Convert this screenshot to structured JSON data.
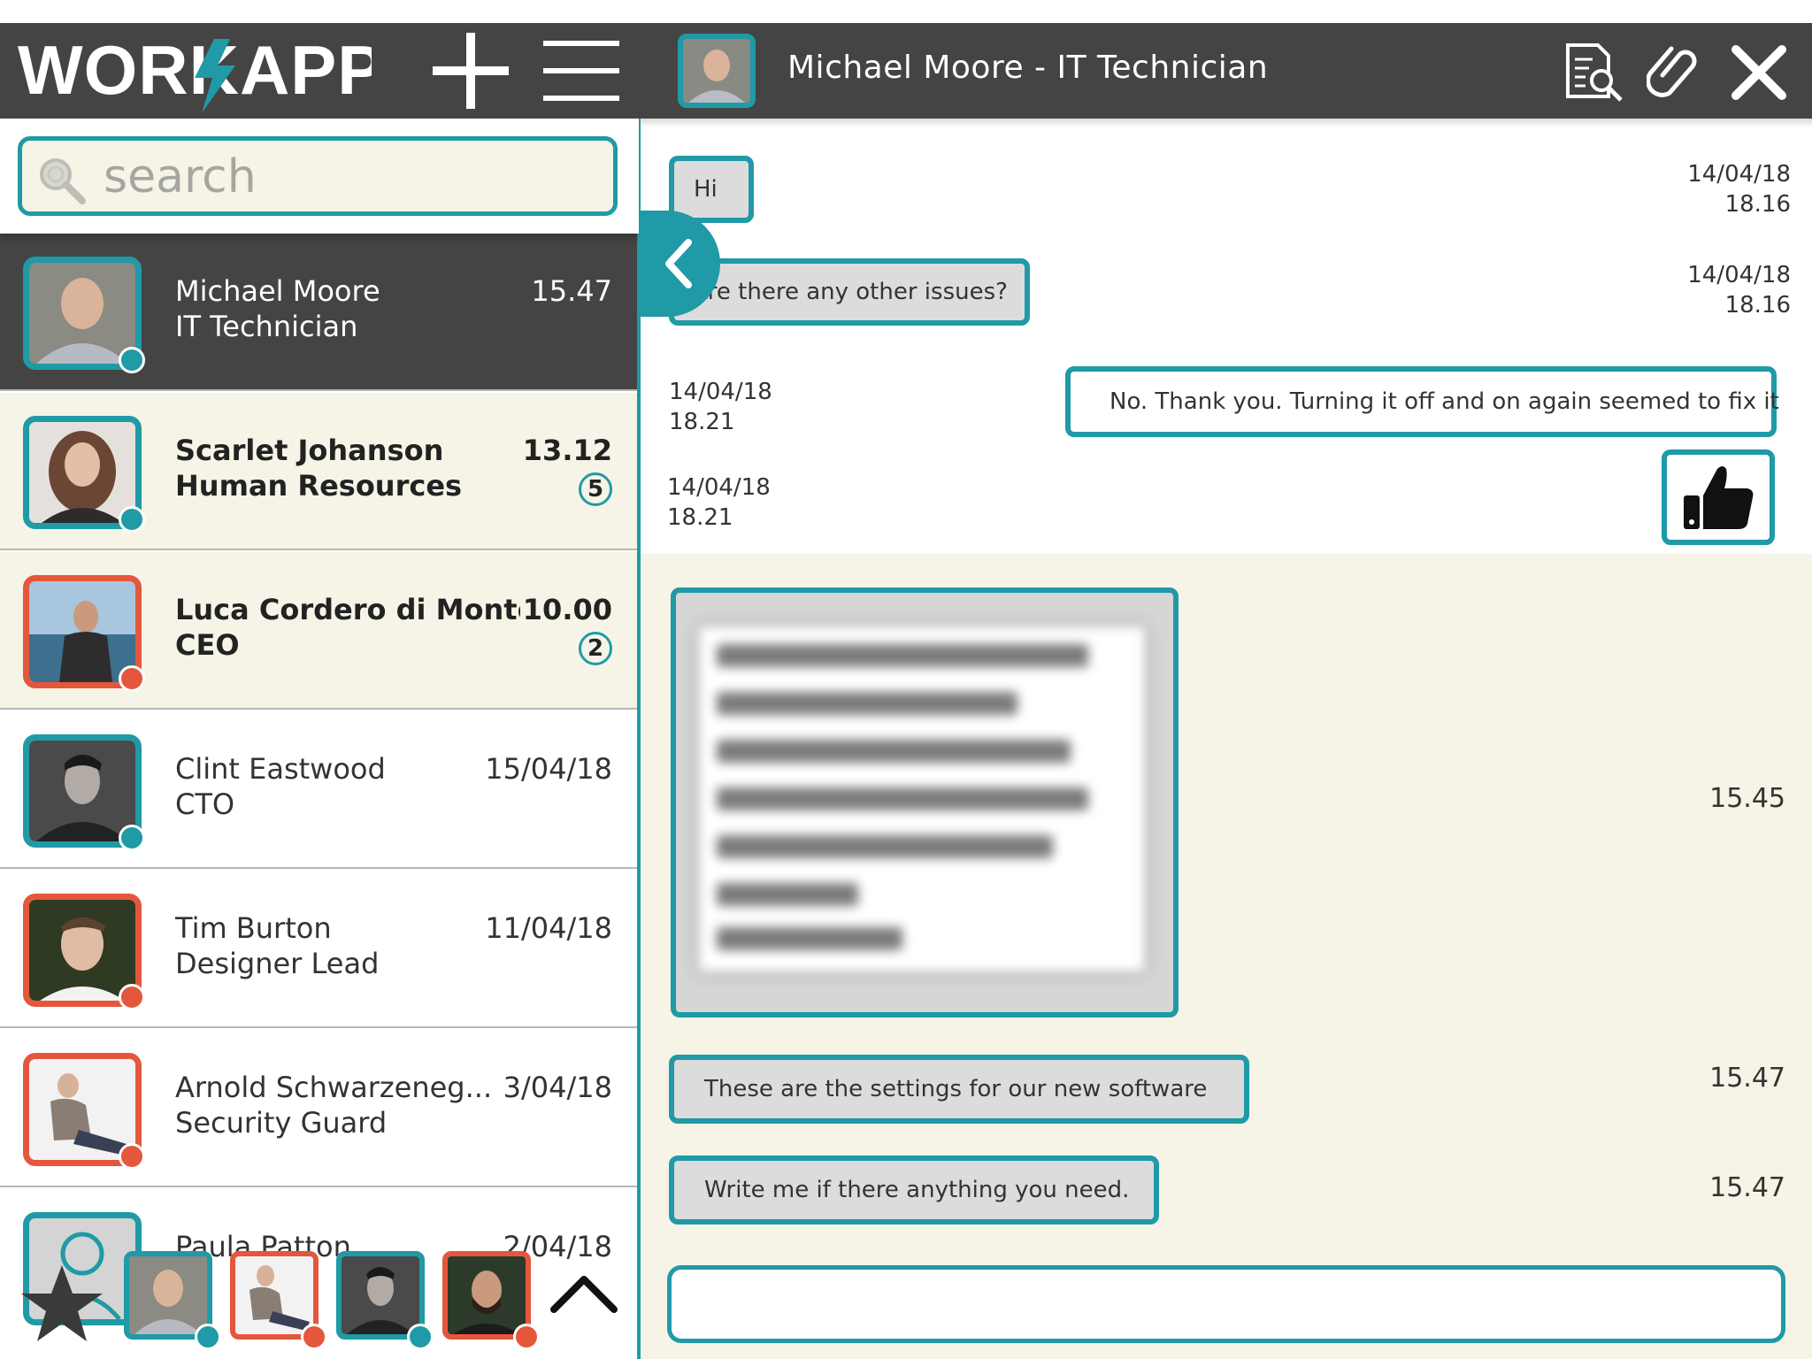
{
  "app": {
    "logo_text": "WORKAPP"
  },
  "header": {
    "title": "Michael Moore - IT Technician"
  },
  "search": {
    "placeholder": "search"
  },
  "contacts": [
    {
      "name": "Michael Moore",
      "role": "IT Technician",
      "time": "15.47",
      "badge": ""
    },
    {
      "name": "Scarlet Johanson",
      "role": "Human Resources",
      "time": "13.12",
      "badge": "5"
    },
    {
      "name": "Luca Cordero di Monte...",
      "role": "CEO",
      "time": "10.00",
      "badge": "2"
    },
    {
      "name": "Clint Eastwood",
      "role": "CTO",
      "time": "15/04/18",
      "badge": ""
    },
    {
      "name": "Tim Burton",
      "role": "Designer Lead",
      "time": "11/04/18",
      "badge": ""
    },
    {
      "name": "Arnold Schwarzeneg...",
      "role": "Security Guard",
      "time": "3/04/18",
      "badge": ""
    },
    {
      "name": "Paula Patton",
      "role": "",
      "time": "2/04/18",
      "badge": ""
    }
  ],
  "messages": [
    {
      "text": "Hi",
      "date": "14/04/18",
      "time": "18.16"
    },
    {
      "text": "Are there any other issues?",
      "date": "14/04/18",
      "time": "18.16"
    },
    {
      "text": "No. Thank you. Turning it off and on again seemed to fix it",
      "date": "14/04/18",
      "time": "18.21"
    },
    {
      "text": "",
      "date": "14/04/18",
      "time": "18.21"
    },
    {
      "text": "",
      "date": "",
      "time": "15.45"
    },
    {
      "text": "These are the settings for our new software",
      "date": "",
      "time": "15.47"
    },
    {
      "text": "Write me if there anything you need.",
      "date": "",
      "time": "15.47"
    }
  ],
  "colors": {
    "accent": "#1f9aa6",
    "alert": "#e4573d",
    "dark": "#444444",
    "cream": "#f5f4e6"
  },
  "icons": [
    "plus-icon",
    "hamburger-menu-icon",
    "search-document-icon",
    "paperclip-icon",
    "close-icon",
    "magnifier-icon",
    "chevron-left-icon",
    "thumbs-up-icon",
    "star-icon",
    "chevron-up-icon"
  ]
}
